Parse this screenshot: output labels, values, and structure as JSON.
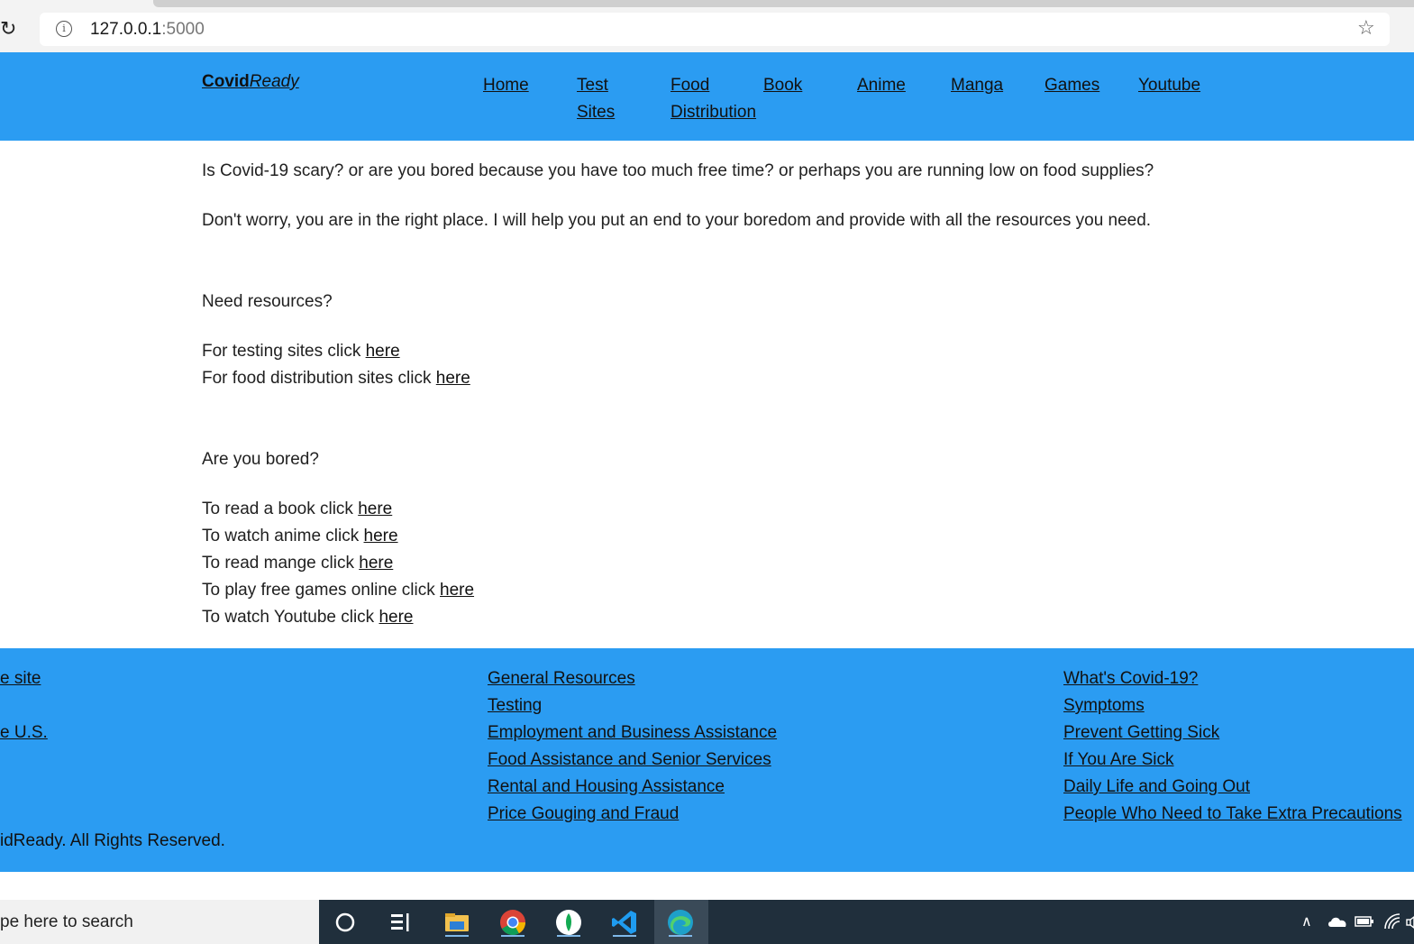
{
  "browser": {
    "url_host": "127.0.0.1",
    "url_port": ":5000"
  },
  "header": {
    "brand_bold": "Covid",
    "brand_italic": "Ready",
    "nav": [
      "Home",
      "Test",
      "Sites",
      "Food",
      "Distribution",
      "Book",
      "Anime",
      "Manga",
      "Games",
      "Youtube"
    ]
  },
  "content": {
    "intro1": "Is Covid-19 scary? or are you bored because you have too much free time? or perhaps you are running low on food supplies?",
    "intro2": "Don't worry, you are in the right place. I will help you put an end to your boredom and provide with all the resources you need.",
    "resources_heading": "Need resources?",
    "testing_text": "For testing sites click ",
    "food_text": "For food distribution sites click ",
    "bored_heading": "Are you bored?",
    "book_text": "To read a book click ",
    "anime_text": "To watch anime click ",
    "manga_text": "To read mange click ",
    "games_text": "To play free games online click ",
    "youtube_text": "To watch Youtube click ",
    "link_label": "here"
  },
  "footer": {
    "left_links": [
      "e site",
      "e U.S."
    ],
    "copyright": "idReady. All Rights Reserved.",
    "middle_links": [
      "General Resources",
      "Testing",
      "Employment and Business Assistance",
      "Food Assistance and Senior Services",
      "Rental and Housing Assistance",
      "Price Gouging and Fraud"
    ],
    "right_links": [
      "What's Covid-19?",
      "Symptoms",
      "Prevent Getting Sick",
      "If You Are Sick",
      "Daily Life and Going Out",
      "People Who Need to Take Extra Precautions"
    ]
  },
  "taskbar": {
    "search_placeholder": "pe here to search"
  },
  "colors": {
    "accent": "#2b9cf2",
    "taskbar": "#202f3c"
  }
}
